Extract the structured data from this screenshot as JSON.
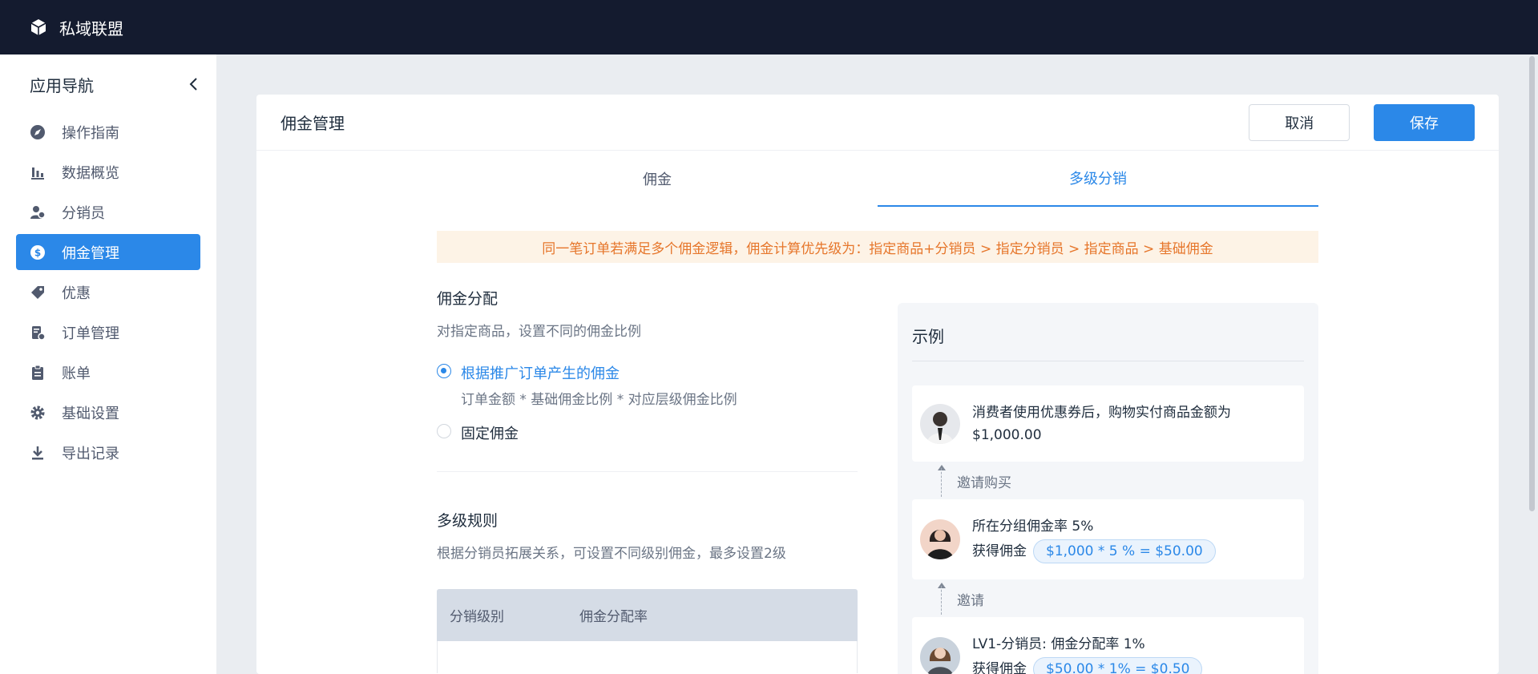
{
  "app": {
    "brand": "私域联盟"
  },
  "sidebar": {
    "title": "应用导航",
    "items": [
      {
        "label": "操作指南",
        "icon": "rocket-icon"
      },
      {
        "label": "数据概览",
        "icon": "bar-chart-icon"
      },
      {
        "label": "分销员",
        "icon": "users-icon"
      },
      {
        "label": "佣金管理",
        "icon": "dollar-icon",
        "active": true
      },
      {
        "label": "优惠",
        "icon": "tag-icon"
      },
      {
        "label": "订单管理",
        "icon": "order-icon"
      },
      {
        "label": "账单",
        "icon": "clipboard-icon"
      },
      {
        "label": "基础设置",
        "icon": "gear-icon"
      },
      {
        "label": "导出记录",
        "icon": "download-icon"
      }
    ]
  },
  "header": {
    "title": "佣金管理",
    "cancel_label": "取消",
    "save_label": "保存"
  },
  "tabs": [
    {
      "label": "佣金",
      "active": false
    },
    {
      "label": "多级分销",
      "active": true
    }
  ],
  "notice": "同一笔订单若满足多个佣金逻辑，佣金计算优先级为：指定商品+分销员 > 指定分销员 > 指定商品 > 基础佣金",
  "allocation": {
    "title": "佣金分配",
    "desc": "对指定商品，设置不同的佣金比例",
    "options": [
      {
        "label": "根据推广订单产生的佣金",
        "sub": "订单金额 * 基础佣金比例 * 对应层级佣金比例",
        "checked": true
      },
      {
        "label": "固定佣金",
        "checked": false
      }
    ]
  },
  "rules": {
    "title": "多级规则",
    "desc": "根据分销员拓展关系，可设置不同级别佣金，最多设置2级",
    "columns": [
      "分销级别",
      "佣金分配率"
    ]
  },
  "example": {
    "title": "示例",
    "step1": {
      "text": "消费者使用优惠券后，购物实付商品金额为 $1,000.00"
    },
    "conn1": "邀请购买",
    "step2": {
      "line1": "所在分组佣金率 5%",
      "label": "获得佣金",
      "formula": "$1,000 * 5 % = $50.00"
    },
    "conn2": "邀请",
    "step3": {
      "line1": "LV1-分销员: 佣金分配率 1%",
      "label": "获得佣金",
      "formula": "$50.00 * 1% = $0.50"
    }
  },
  "colors": {
    "primary": "#2b88e8",
    "topbar": "#141b2f",
    "notice_bg": "#fdf3e6",
    "notice_text": "#e6762b"
  }
}
